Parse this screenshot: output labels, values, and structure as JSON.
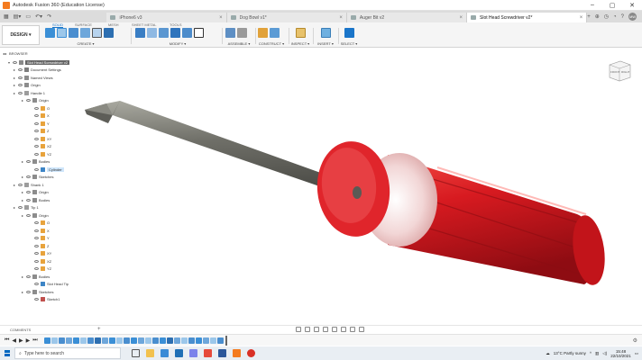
{
  "window": {
    "title": "Autodesk Fusion 360 (Education License)",
    "minimize": "–",
    "maximize": "▢",
    "close": "✕"
  },
  "tabs": [
    {
      "label": "iPhone6 v3",
      "active": false
    },
    {
      "label": "Dog Bowl v1*",
      "active": false
    },
    {
      "label": "Auger Bit v2",
      "active": false
    },
    {
      "label": "Slot Head Screwdriver v2*",
      "active": true
    }
  ],
  "toolbar": {
    "workspace_label": "DESIGN",
    "workspace_tabs": [
      "SOLID",
      "SURFACE",
      "MESH",
      "SHEET METAL",
      "TOOLS"
    ],
    "active_workspace_tab": "SOLID",
    "groups": [
      "CREATE",
      "MODIFY",
      "ASSEMBLE",
      "CONSTRUCT",
      "INSPECT",
      "INSERT",
      "SELECT"
    ]
  },
  "browser": {
    "title": "BROWSER",
    "items": [
      {
        "label": "Slot Head Screwdriver v2",
        "level": 0,
        "icon": "document-icon",
        "style": "hl"
      },
      {
        "label": "Document Settings",
        "level": 1,
        "icon": "gear-icon",
        "style": ""
      },
      {
        "label": "Named Views",
        "level": 1,
        "icon": "folder-icon",
        "style": ""
      },
      {
        "label": "Origin",
        "level": 1,
        "icon": "folder-icon",
        "style": ""
      },
      {
        "label": "Handle 1",
        "level": 1,
        "icon": "component-icon",
        "style": ""
      },
      {
        "label": "Origin",
        "level": 2,
        "icon": "folder-icon",
        "style": ""
      },
      {
        "label": "O",
        "level": 3,
        "icon": "origin-point-icon",
        "style": ""
      },
      {
        "label": "X",
        "level": 3,
        "icon": "axis-icon",
        "style": ""
      },
      {
        "label": "Y",
        "level": 3,
        "icon": "axis-icon",
        "style": ""
      },
      {
        "label": "Z",
        "level": 3,
        "icon": "axis-icon",
        "style": ""
      },
      {
        "label": "XY",
        "level": 3,
        "icon": "plane-icon",
        "style": ""
      },
      {
        "label": "XZ",
        "level": 3,
        "icon": "plane-icon",
        "style": ""
      },
      {
        "label": "YZ",
        "level": 3,
        "icon": "plane-icon",
        "style": ""
      },
      {
        "label": "Bodies",
        "level": 2,
        "icon": "folder-icon",
        "style": ""
      },
      {
        "label": "Cylinder",
        "level": 3,
        "icon": "body-icon",
        "style": "sel"
      },
      {
        "label": "Sketches",
        "level": 2,
        "icon": "folder-icon",
        "style": ""
      },
      {
        "label": "Shank 1",
        "level": 1,
        "icon": "component-icon",
        "style": ""
      },
      {
        "label": "Origin",
        "level": 2,
        "icon": "folder-icon",
        "style": ""
      },
      {
        "label": "Bodies",
        "level": 2,
        "icon": "folder-icon",
        "style": ""
      },
      {
        "label": "Tip 1",
        "level": 1,
        "icon": "component-icon",
        "style": ""
      },
      {
        "label": "Origin",
        "level": 2,
        "icon": "folder-icon",
        "style": ""
      },
      {
        "label": "O",
        "level": 3,
        "icon": "origin-point-icon",
        "style": ""
      },
      {
        "label": "X",
        "level": 3,
        "icon": "axis-icon",
        "style": ""
      },
      {
        "label": "Y",
        "level": 3,
        "icon": "axis-icon",
        "style": ""
      },
      {
        "label": "Z",
        "level": 3,
        "icon": "axis-icon",
        "style": ""
      },
      {
        "label": "XY",
        "level": 3,
        "icon": "plane-icon",
        "style": ""
      },
      {
        "label": "XZ",
        "level": 3,
        "icon": "plane-icon",
        "style": ""
      },
      {
        "label": "YZ",
        "level": 3,
        "icon": "plane-icon",
        "style": ""
      },
      {
        "label": "Bodies",
        "level": 2,
        "icon": "folder-icon",
        "style": ""
      },
      {
        "label": "Slot Head Tip",
        "level": 3,
        "icon": "body-icon",
        "style": ""
      },
      {
        "label": "Sketches",
        "level": 2,
        "icon": "folder-icon",
        "style": ""
      },
      {
        "label": "Sketch1",
        "level": 3,
        "icon": "sketch-icon",
        "style": ""
      }
    ]
  },
  "viewcube": {
    "top": "FRONT",
    "right": "RIGHT"
  },
  "comments": {
    "label": "COMMENTS",
    "add": "+"
  },
  "timeline": {
    "controls": [
      "⏮",
      "◀",
      "▶",
      "▶",
      "⏭"
    ],
    "settings": "⚙"
  },
  "taskbar": {
    "search_placeholder": "Type here to search",
    "weather": "13°C  Partly sunny",
    "time": "15:48",
    "date": "22/10/2021"
  },
  "colors": {
    "accent": "#1a75c9",
    "handle_red": "#d7191f",
    "shaft_grey": "#7a7a72",
    "fusion_orange": "#f47b20"
  }
}
